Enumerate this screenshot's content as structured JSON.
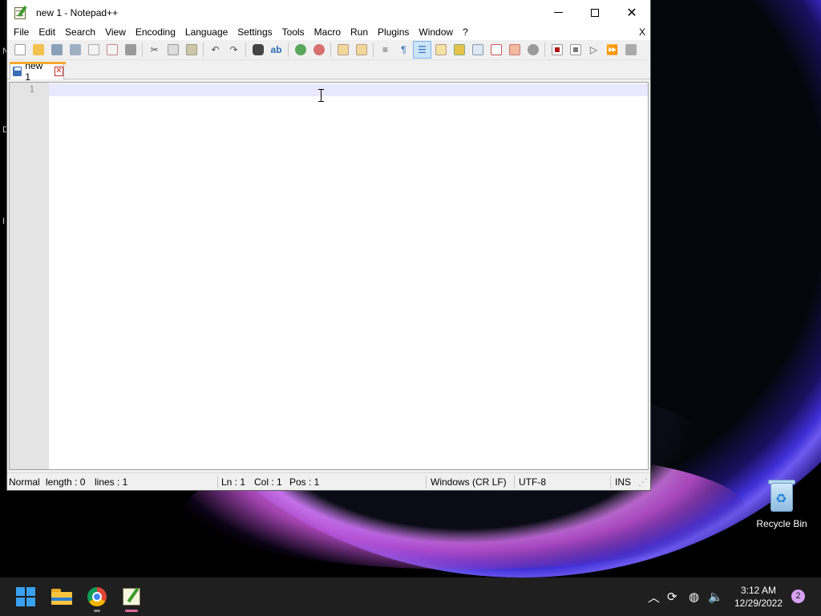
{
  "window": {
    "title": "new 1 - Notepad++",
    "menu": [
      "File",
      "Edit",
      "Search",
      "View",
      "Encoding",
      "Language",
      "Settings",
      "Tools",
      "Macro",
      "Run",
      "Plugins",
      "Window",
      "?"
    ],
    "menu_close": "X"
  },
  "tab": {
    "label": "new 1",
    "close": "✕"
  },
  "editor": {
    "line_number": "1"
  },
  "status": {
    "mode": "Normal",
    "length": "length : 0",
    "lines": "lines : 1",
    "ln": "Ln : 1",
    "col": "Col : 1",
    "pos": "Pos : 1",
    "eol": "Windows (CR LF)",
    "encoding": "UTF-8",
    "ins": "INS"
  },
  "desktop": {
    "recycle_bin_label": "Recycle Bin",
    "left_edge_letters": [
      "N",
      "D",
      "I"
    ]
  },
  "taskbar": {
    "time": "3:12 AM",
    "date": "12/29/2022",
    "notifications": "2"
  },
  "colors": {
    "accent_tab": "#f7a930",
    "current_line": "#e8e8ff",
    "taskbar": "#1f1f1f"
  }
}
